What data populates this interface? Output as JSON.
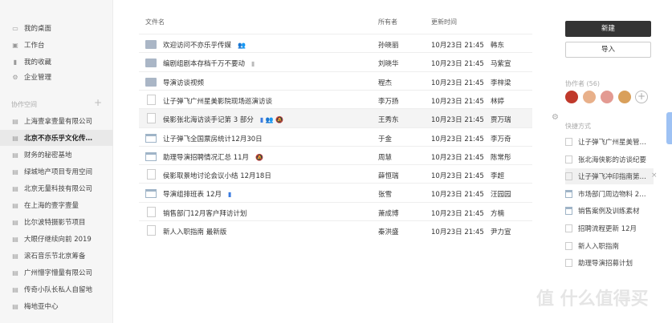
{
  "sidebar": {
    "items": [
      {
        "label": "我的桌面",
        "icon": "desktop-icon"
      },
      {
        "label": "工作台",
        "icon": "workbench-icon"
      },
      {
        "label": "我的收藏",
        "icon": "bookmark-icon"
      },
      {
        "label": "企业管理",
        "icon": "gear-icon"
      }
    ],
    "section_title": "协作空间",
    "spaces": [
      "上海壹拿壹量有限公司",
      "北京不亦乐乎文化传…",
      "财务的秘密基地",
      "绿城地产项目专用空间",
      "北京无量科技有限公司",
      "在上海的壹字壹量",
      "比尔波特摄影节项目",
      "大眼仔继续向前 2019",
      "滚石音乐节北京筹备",
      "广州懵字懵量有限公司",
      "传奇小队长私人自留地",
      "梅地亚中心"
    ]
  },
  "table": {
    "headers": {
      "name": "文件名",
      "owner": "所有者",
      "time": "更新时间"
    },
    "rows": [
      {
        "type": "folder",
        "name": "欢迎访问不亦乐乎传媒",
        "tag": "👥",
        "tag_color": "gray",
        "owner": "孙晓丽",
        "time": "10月23日 21:45",
        "editor": "韩东"
      },
      {
        "type": "folder",
        "name": "编剧组剧本存档千万不要动",
        "tag": "▮",
        "tag_color": "gray",
        "owner": "刘晓华",
        "time": "10月23日 21:45",
        "editor": "马紫宣"
      },
      {
        "type": "folder",
        "name": "导演访谈视频",
        "tag": "",
        "tag_color": "gray",
        "owner": "程杰",
        "time": "10月23日 21:45",
        "editor": "李梓梁"
      },
      {
        "type": "doc",
        "name": "让子弹飞广州星美影院现场巡演访谈",
        "tag": "",
        "tag_color": "gray",
        "owner": "李万扬",
        "time": "10月23日 21:45",
        "editor": "林婷"
      },
      {
        "type": "doc",
        "name": "侯影张北海访谈手记第 3 部分",
        "tag": "▮  👥  🔕",
        "tag_color": "blue",
        "owner": "王秀东",
        "time": "10月23日 21:45",
        "editor": "贾万瑞"
      },
      {
        "type": "sheet",
        "name": "让子弹飞全国票房统计12月30日",
        "tag": "",
        "tag_color": "gray",
        "owner": "于金",
        "time": "10月23日 21:45",
        "editor": "李万奇"
      },
      {
        "type": "sheet",
        "name": "助理导演招聘情况汇总 11月",
        "tag": "🔕",
        "tag_color": "gray",
        "owner": "周慧",
        "time": "10月23日 21:45",
        "editor": "陈常彤"
      },
      {
        "type": "doc",
        "name": "侯影取景地讨论会议小结 12月18日",
        "tag": "",
        "tag_color": "gray",
        "owner": "薛恒瑞",
        "time": "10月23日 21:45",
        "editor": "李超"
      },
      {
        "type": "sheet",
        "name": "导演组排班表 12月",
        "tag": "▮",
        "tag_color": "blue",
        "owner": "张雪",
        "time": "10月23日 21:45",
        "editor": "汪园园"
      },
      {
        "type": "doc",
        "name": "销售部门12月客户拜访计划",
        "tag": "",
        "tag_color": "gray",
        "owner": "萧成博",
        "time": "10月23日 21:45",
        "editor": "方楠"
      },
      {
        "type": "doc",
        "name": "新人入职指南 最新版",
        "tag": "",
        "tag_color": "gray",
        "owner": "秦洪盛",
        "time": "10月23日 21:45",
        "editor": "尹力宣"
      }
    ],
    "row_more_icon": "settings-icon"
  },
  "right": {
    "new_label": "新建",
    "import_label": "导入",
    "collab_title": "协作者 (56)",
    "avatars": [
      "#c0392b",
      "#e8b08a",
      "#e39a92",
      "#d9a05b"
    ],
    "quick_title": "快捷方式",
    "quick": [
      {
        "label": "让子弹飞广州星美管…",
        "type": "doc"
      },
      {
        "label": "张北海侠影的访谈纪要",
        "type": "doc"
      },
      {
        "label": "让子弹飞冲印指南第…",
        "type": "doc"
      },
      {
        "label": "市场部门周边物料 2…",
        "type": "sheet"
      },
      {
        "label": "销售案例及训练素材",
        "type": "sheet"
      },
      {
        "label": "招聘流程更新 12月",
        "type": "doc"
      },
      {
        "label": "新人入职指南",
        "type": "doc"
      },
      {
        "label": "助理导演招募计划",
        "type": "doc"
      }
    ]
  },
  "watermark": "值 什么值得买"
}
